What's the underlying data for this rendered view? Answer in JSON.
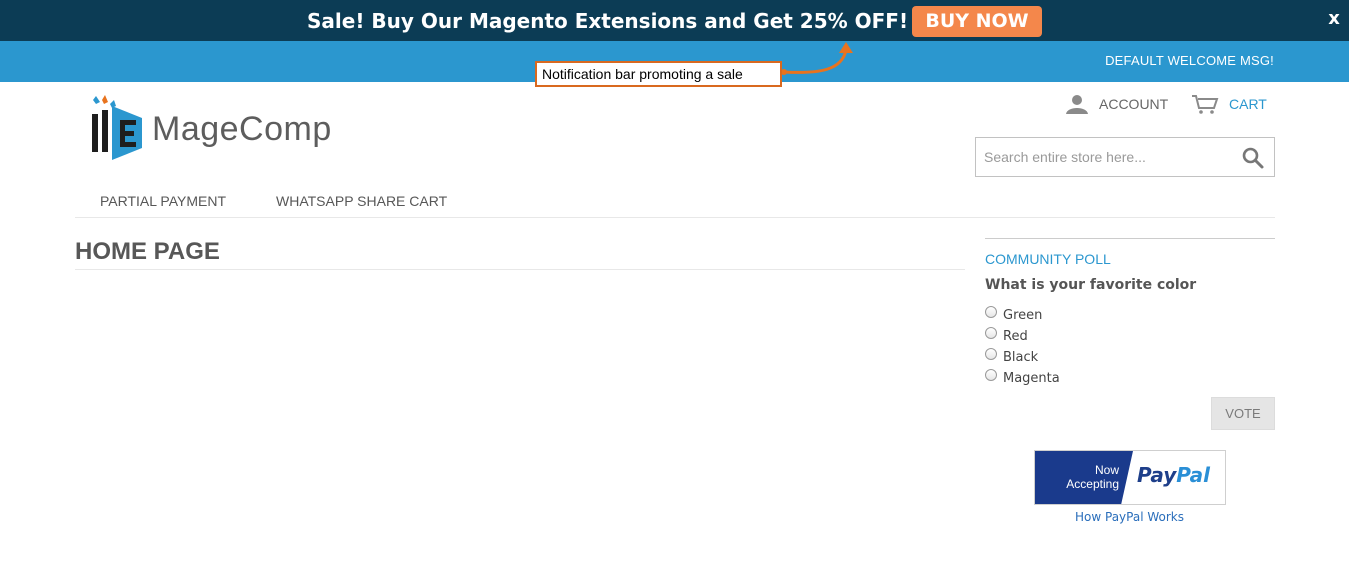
{
  "notification": {
    "message": "Sale! Buy Our Magento Extensions and Get 25% OFF!",
    "cta_label": "BUY NOW",
    "close_label": "x"
  },
  "panel": {
    "welcome": "DEFAULT WELCOME MSG!"
  },
  "annotation": {
    "text": "Notification bar promoting a sale"
  },
  "header": {
    "logo_text": "MageComp",
    "account_label": "ACCOUNT",
    "cart_label": "CART",
    "search_placeholder": "Search entire store here..."
  },
  "nav": {
    "items": [
      {
        "label": "PARTIAL PAYMENT"
      },
      {
        "label": "WHATSAPP SHARE CART"
      }
    ]
  },
  "main": {
    "title": "HOME PAGE"
  },
  "poll": {
    "title": "COMMUNITY POLL",
    "question": "What is your favorite color",
    "options": [
      {
        "label": "Green"
      },
      {
        "label": "Red"
      },
      {
        "label": "Black"
      },
      {
        "label": "Magenta"
      }
    ],
    "vote_label": "VOTE"
  },
  "paypal": {
    "now": "Now",
    "accepting": "Accepting",
    "brand_pay": "Pay",
    "brand_pal": "Pal",
    "link": "How PayPal Works"
  },
  "colors": {
    "notification_bg": "#0c3c55",
    "cta_bg": "#f4874b",
    "panel_bg": "#2b97cf",
    "annotation_border": "#d9691f",
    "link_blue": "#2b97cf"
  },
  "icons": [
    "close-icon",
    "arrow-icon",
    "logo-mark-icon",
    "user-icon",
    "cart-icon",
    "search-icon"
  ]
}
